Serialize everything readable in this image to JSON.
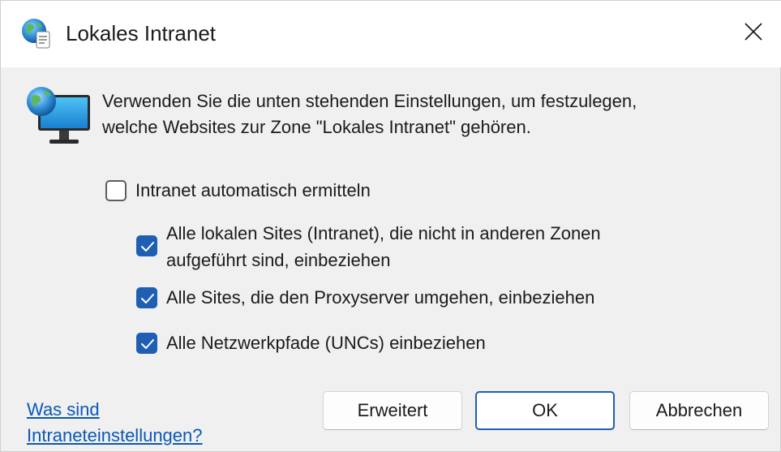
{
  "window": {
    "title": "Lokales Intranet"
  },
  "description": {
    "line1": "Verwenden Sie die unten stehenden Einstellungen, um festzulegen,",
    "line2": "welche Websites zur Zone \"Lokales Intranet\" gehören."
  },
  "options": {
    "auto_detect": {
      "label": "Intranet automatisch ermitteln",
      "checked": false
    },
    "local_sites": {
      "label_line1": "Alle lokalen Sites (Intranet), die nicht in anderen Zonen",
      "label_line2": "aufgeführt sind, einbeziehen",
      "checked": true
    },
    "proxy_bypass": {
      "label": "Alle Sites, die den Proxyserver umgehen, einbeziehen",
      "checked": true
    },
    "unc_paths": {
      "label": "Alle Netzwerkpfade (UNCs) einbeziehen",
      "checked": true
    }
  },
  "help_link": {
    "line1": "Was sind",
    "line2": "Intraneteinstellungen?"
  },
  "buttons": {
    "advanced": "Erweitert",
    "ok": "OK",
    "cancel": "Abbrechen"
  },
  "icons": {
    "title": "globe-document-icon",
    "content": "globe-monitor-icon",
    "close": "close-icon",
    "check": "checkmark-icon"
  },
  "colors": {
    "accent": "#1e5fb3",
    "link": "#0a58b8",
    "background": "#f0f0f0",
    "titlebar": "#ffffff"
  }
}
